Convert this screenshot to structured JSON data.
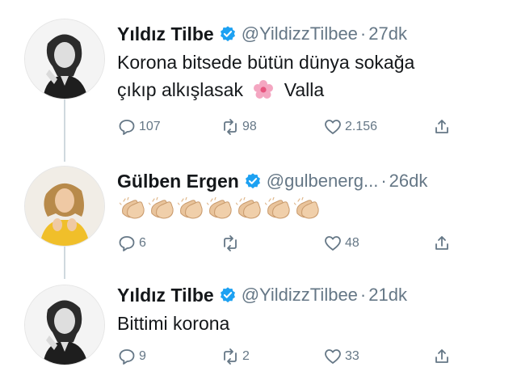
{
  "tweets": [
    {
      "name": "Yıldız Tilbe",
      "handle": "@YildizzTilbee",
      "separator": "·",
      "time": "27dk",
      "text_line1": "Korona bitsede bütün dünya sokağa",
      "text_line2_before": "çıkıp alkışlasak",
      "text_line2_after": "Valla",
      "reply_count": "107",
      "retweet_count": "98",
      "like_count": "2.156"
    },
    {
      "name": "Gülben Ergen",
      "handle": "@gulbenerg...",
      "separator": "·",
      "time": "26dk",
      "clap_count": 7,
      "reply_count": "6",
      "retweet_count": "",
      "like_count": "48"
    },
    {
      "name": "Yıldız Tilbe",
      "handle": "@YildizzTilbee",
      "separator": "·",
      "time": "21dk",
      "text_line1": "Bittimi korona",
      "reply_count": "9",
      "retweet_count": "2",
      "like_count": "33"
    }
  ],
  "colors": {
    "verified": "#1da1f2",
    "muted": "#657786",
    "thread_line": "#cfd9de"
  },
  "icons": [
    "verified-badge-icon",
    "reply-icon",
    "retweet-icon",
    "like-icon",
    "share-icon",
    "pink-flower-emoji",
    "clapping-hands-emoji"
  ]
}
